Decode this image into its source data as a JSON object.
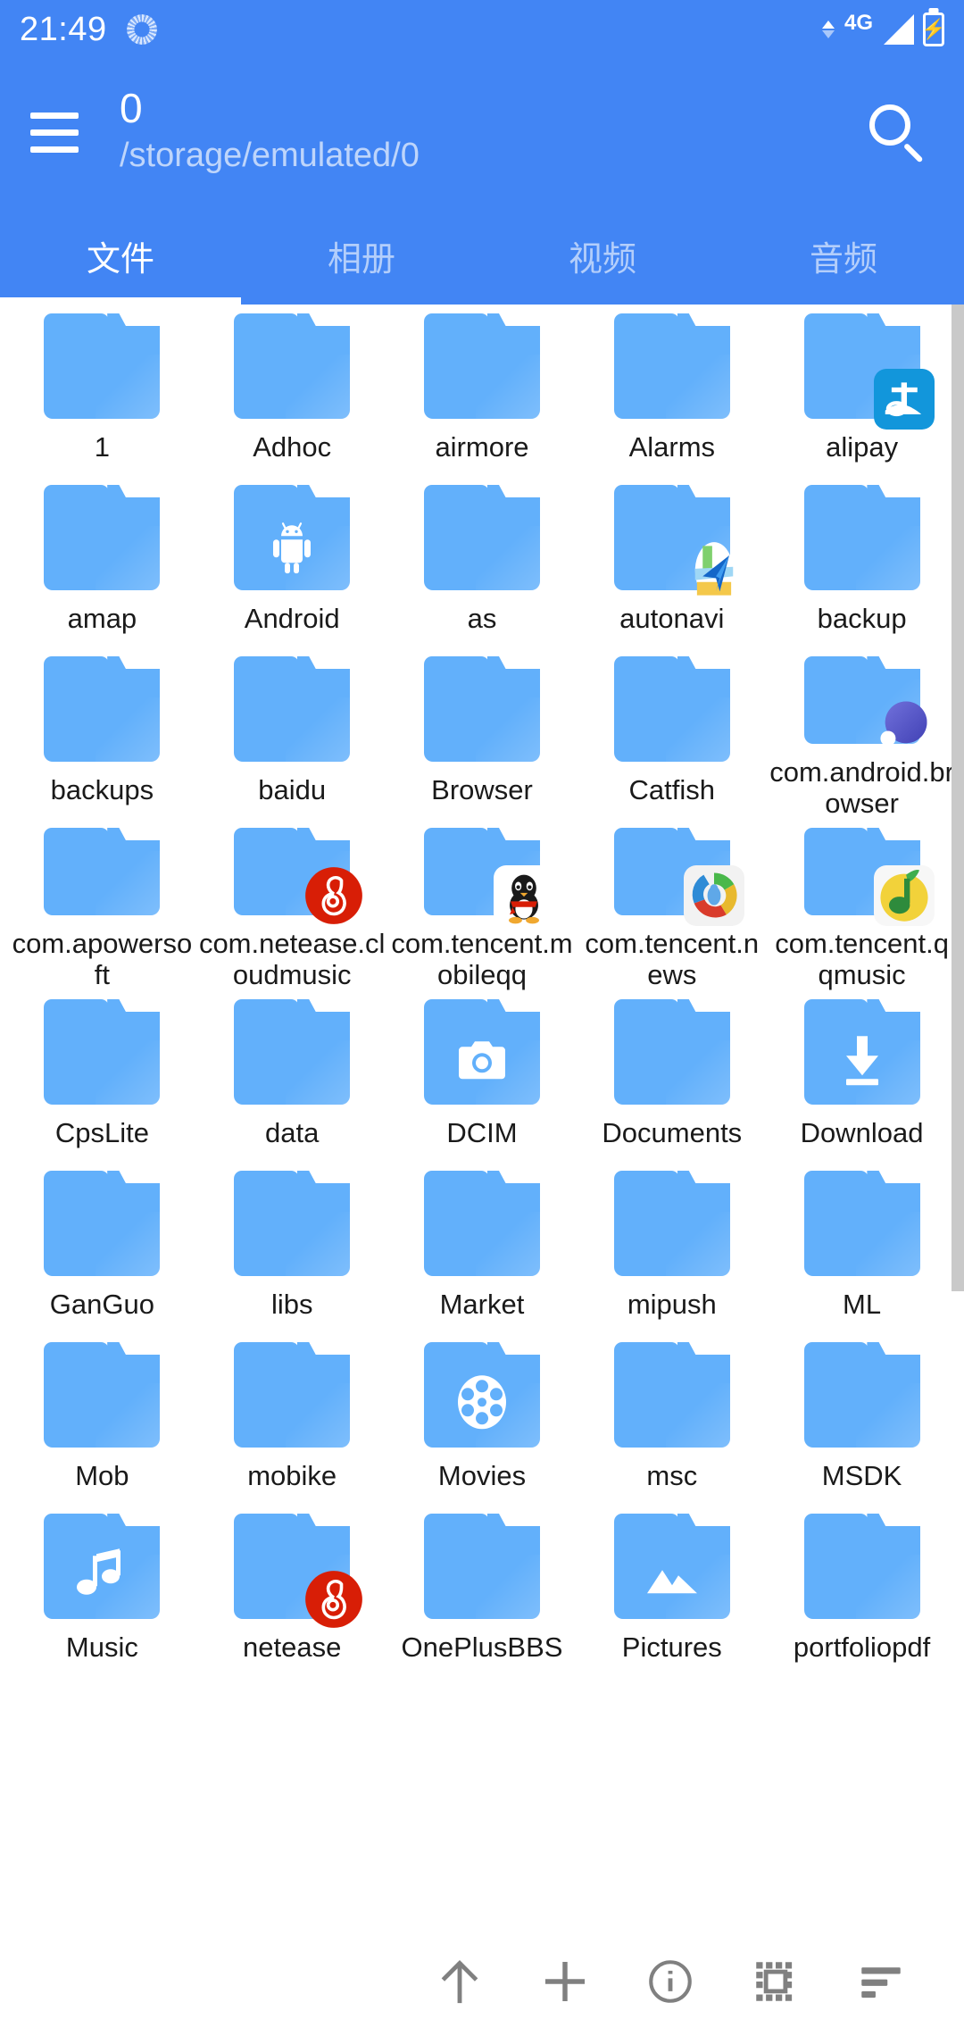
{
  "status_bar": {
    "time": "21:49",
    "network_type": "4G",
    "spinner_icon": "loading-spinner-icon",
    "signal_icon": "signal-bars-icon",
    "battery_icon": "battery-charging-icon",
    "data_icon": "data-transfer-icon"
  },
  "app_bar": {
    "menu_icon": "hamburger-menu-icon",
    "title": "0",
    "path": "/storage/emulated/0",
    "search_icon": "search-icon"
  },
  "tabs": [
    {
      "label": "文件",
      "active": true
    },
    {
      "label": "相册",
      "active": false
    },
    {
      "label": "视频",
      "active": false
    },
    {
      "label": "音频",
      "active": false
    }
  ],
  "colors": {
    "app_bar_blue": "#4285F4",
    "folder_blue": "#62B0FB",
    "label_text": "#1a1a1a",
    "tab_inactive": "rgba(255,255,255,0.6)",
    "toolbar_icon": "#808080",
    "scrollbar": "#c9c9c9"
  },
  "files": [
    {
      "name": "1",
      "glyph": null,
      "badge": null
    },
    {
      "name": "Adhoc",
      "glyph": null,
      "badge": null
    },
    {
      "name": "airmore",
      "glyph": null,
      "badge": null
    },
    {
      "name": "Alarms",
      "glyph": null,
      "badge": null
    },
    {
      "name": "alipay",
      "glyph": null,
      "badge": "alipay-icon"
    },
    {
      "name": "amap",
      "glyph": null,
      "badge": null
    },
    {
      "name": "Android",
      "glyph": "android-icon",
      "badge": null
    },
    {
      "name": "as",
      "glyph": null,
      "badge": null
    },
    {
      "name": "autonavi",
      "glyph": null,
      "badge": "autonavi-map-icon"
    },
    {
      "name": "backup",
      "glyph": null,
      "badge": null
    },
    {
      "name": "backups",
      "glyph": null,
      "badge": null
    },
    {
      "name": "baidu",
      "glyph": null,
      "badge": null
    },
    {
      "name": "Browser",
      "glyph": null,
      "badge": null
    },
    {
      "name": "Catfish",
      "glyph": null,
      "badge": null
    },
    {
      "name": "com.android.browser",
      "glyph": null,
      "badge": "browser-icon"
    },
    {
      "name": "com.apowersoft",
      "glyph": null,
      "badge": null
    },
    {
      "name": "com.netease.cloudmusic",
      "glyph": null,
      "badge": "netease-music-icon"
    },
    {
      "name": "com.tencent.mobileqq",
      "glyph": null,
      "badge": "qq-penguin-icon"
    },
    {
      "name": "com.tencent.news",
      "glyph": null,
      "badge": "tencent-news-icon"
    },
    {
      "name": "com.tencent.qqmusic",
      "glyph": null,
      "badge": "qq-music-icon"
    },
    {
      "name": "CpsLite",
      "glyph": null,
      "badge": null
    },
    {
      "name": "data",
      "glyph": null,
      "badge": null
    },
    {
      "name": "DCIM",
      "glyph": "camera-icon",
      "badge": null
    },
    {
      "name": "Documents",
      "glyph": null,
      "badge": null
    },
    {
      "name": "Download",
      "glyph": "download-icon",
      "badge": null
    },
    {
      "name": "GanGuo",
      "glyph": null,
      "badge": null
    },
    {
      "name": "libs",
      "glyph": null,
      "badge": null
    },
    {
      "name": "Market",
      "glyph": null,
      "badge": null
    },
    {
      "name": "mipush",
      "glyph": null,
      "badge": null
    },
    {
      "name": "ML",
      "glyph": null,
      "badge": null
    },
    {
      "name": "Mob",
      "glyph": null,
      "badge": null
    },
    {
      "name": "mobike",
      "glyph": null,
      "badge": null
    },
    {
      "name": "Movies",
      "glyph": "film-reel-icon",
      "badge": null
    },
    {
      "name": "msc",
      "glyph": null,
      "badge": null
    },
    {
      "name": "MSDK",
      "glyph": null,
      "badge": null
    },
    {
      "name": "Music",
      "glyph": "music-note-icon",
      "badge": null
    },
    {
      "name": "netease",
      "glyph": null,
      "badge": "netease-music-icon"
    },
    {
      "name": "OnePlusBBS",
      "glyph": null,
      "badge": null
    },
    {
      "name": "Pictures",
      "glyph": "mountain-image-icon",
      "badge": null
    },
    {
      "name": "portfoliopdf",
      "glyph": null,
      "badge": null
    }
  ],
  "bottom_toolbar": [
    {
      "icon": "up-arrow-icon",
      "name": "navigate-up-button"
    },
    {
      "icon": "plus-icon",
      "name": "add-button"
    },
    {
      "icon": "info-icon",
      "name": "info-button"
    },
    {
      "icon": "select-all-icon",
      "name": "select-all-button"
    },
    {
      "icon": "sort-icon",
      "name": "sort-button"
    }
  ]
}
